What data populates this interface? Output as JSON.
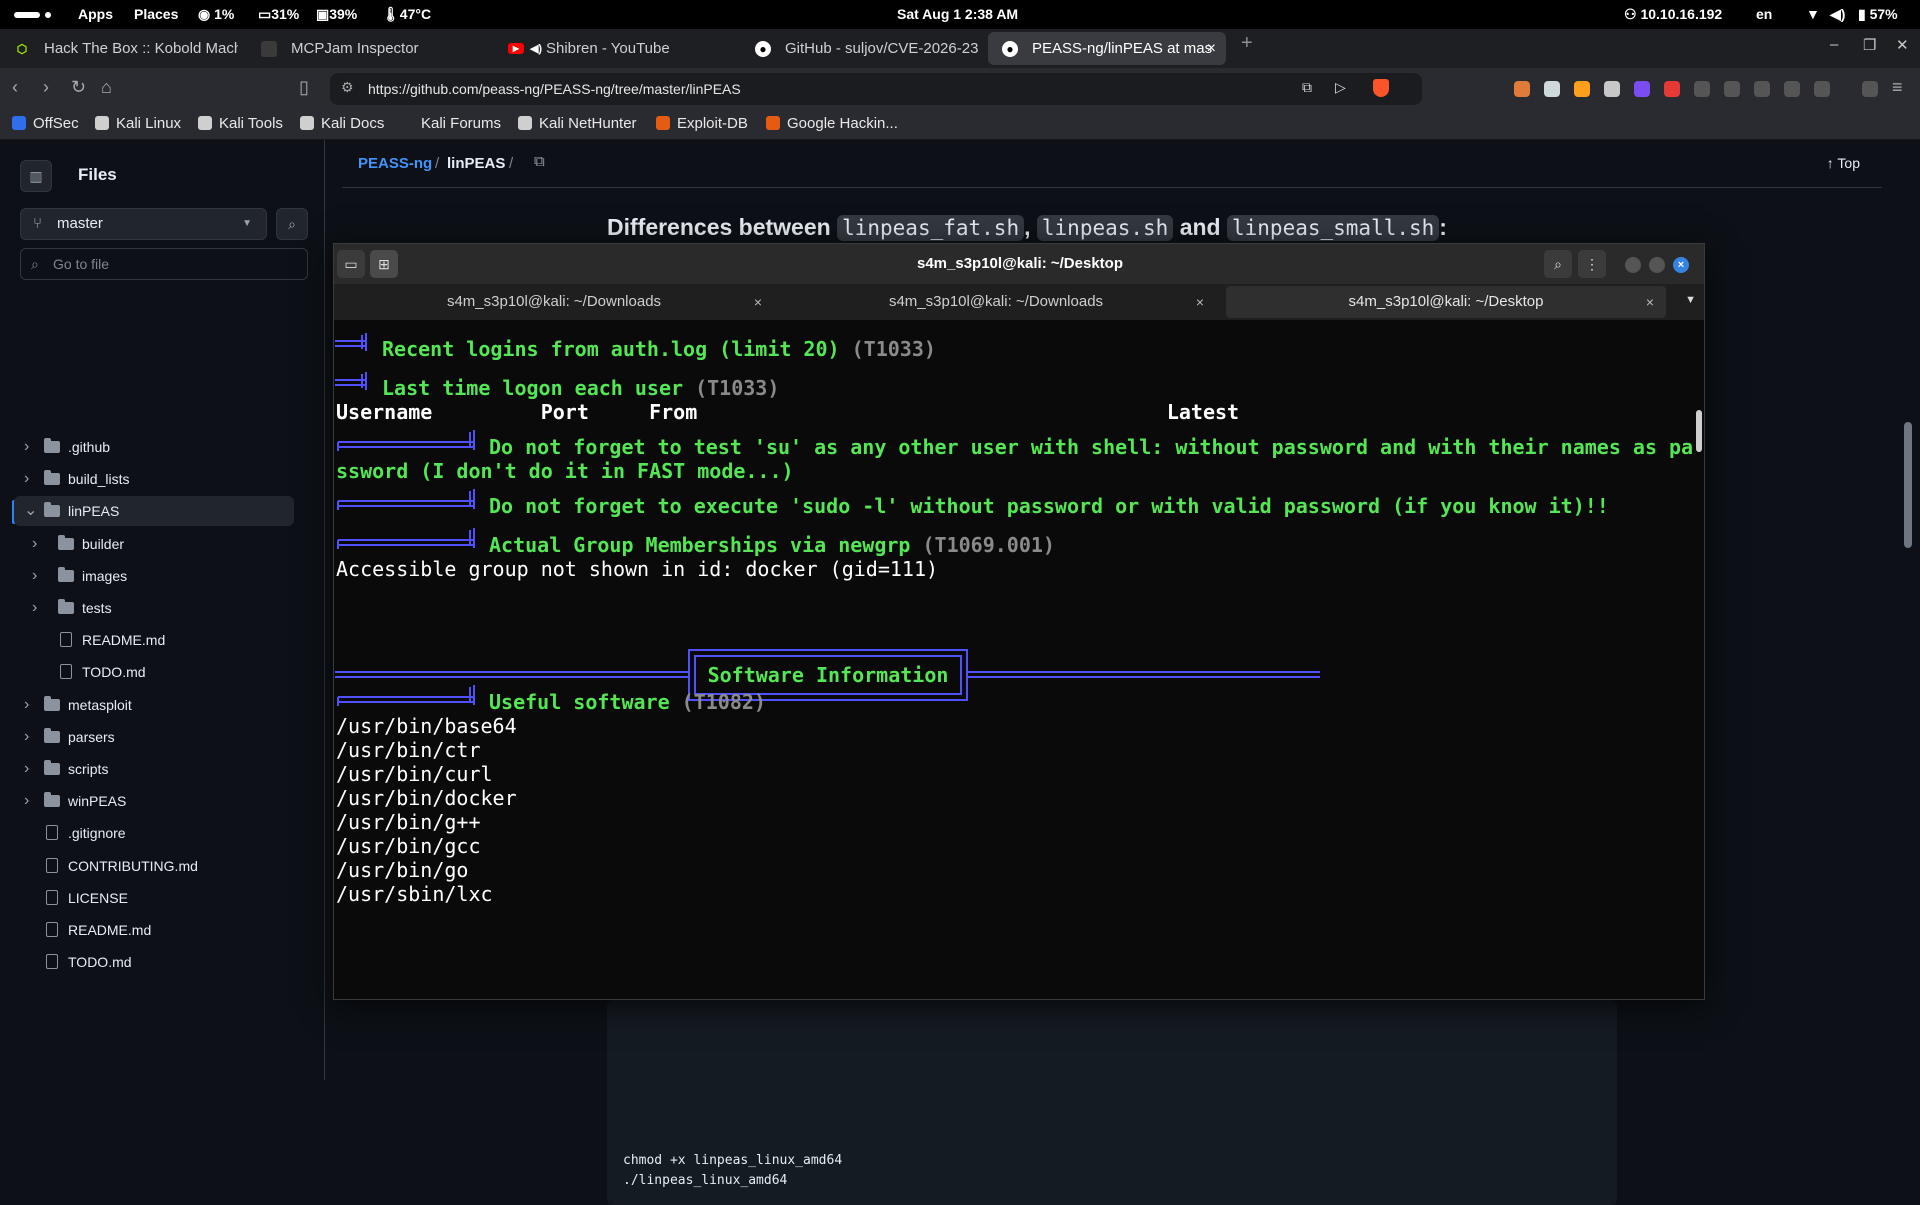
{
  "topbar": {
    "apps": "Apps",
    "places": "Places",
    "cpu": "1%",
    "mem": "31%",
    "swap": "39%",
    "temp": "47°C",
    "datetime": "Sat Aug 1   2:38 AM",
    "ip": "10.10.16.192",
    "lang": "en",
    "battery": "57%"
  },
  "browser_tabs": [
    {
      "label": "Hack The Box :: Kobold Machi",
      "icon_color": "#9fef00"
    },
    {
      "label": "MCPJam Inspector",
      "icon_color": "#3a3a3a"
    },
    {
      "label": "Shibren - YouTube",
      "icon_color": "#ff0000"
    },
    {
      "label": "GitHub - suljov/CVE-2026-23",
      "icon_color": "#ffffff"
    },
    {
      "label": "PEASS-ng/linPEAS at mas",
      "icon_color": "#ffffff"
    }
  ],
  "address": {
    "url": "https://github.com/peass-ng/PEASS-ng/tree/master/linPEAS"
  },
  "bookmarks": [
    "OffSec",
    "Kali Linux",
    "Kali Tools",
    "Kali Docs",
    "Kali Forums",
    "Kali NetHunter",
    "Exploit-DB",
    "Google Hackin..."
  ],
  "github": {
    "files_title": "Files",
    "branch": "master",
    "goto_placeholder": "Go to file",
    "tree": [
      {
        "name": ".github",
        "type": "folder",
        "depth": 0,
        "expanded": false
      },
      {
        "name": "build_lists",
        "type": "folder",
        "depth": 0,
        "expanded": false
      },
      {
        "name": "linPEAS",
        "type": "folder",
        "depth": 0,
        "expanded": true,
        "selected": true
      },
      {
        "name": "builder",
        "type": "folder",
        "depth": 1,
        "expanded": false
      },
      {
        "name": "images",
        "type": "folder",
        "depth": 1,
        "expanded": false
      },
      {
        "name": "tests",
        "type": "folder",
        "depth": 1,
        "expanded": false
      },
      {
        "name": "README.md",
        "type": "file",
        "depth": 1
      },
      {
        "name": "TODO.md",
        "type": "file",
        "depth": 1
      },
      {
        "name": "metasploit",
        "type": "folder",
        "depth": 0,
        "expanded": false
      },
      {
        "name": "parsers",
        "type": "folder",
        "depth": 0,
        "expanded": false
      },
      {
        "name": "scripts",
        "type": "folder",
        "depth": 0,
        "expanded": false
      },
      {
        "name": "winPEAS",
        "type": "folder",
        "depth": 0,
        "expanded": false
      },
      {
        "name": ".gitignore",
        "type": "file",
        "depth": 0
      },
      {
        "name": "CONTRIBUTING.md",
        "type": "file",
        "depth": 0
      },
      {
        "name": "LICENSE",
        "type": "file",
        "depth": 0
      },
      {
        "name": "README.md",
        "type": "file",
        "depth": 0
      },
      {
        "name": "TODO.md",
        "type": "file",
        "depth": 0
      }
    ],
    "breadcrumb": {
      "repo": "PEASS-ng",
      "dir": "linPEAS"
    },
    "top_label": "Top",
    "heading": {
      "prefix": "Differences between ",
      "f1": "linpeas_fat.sh",
      "sep1": ", ",
      "f2": "linpeas.sh",
      "sep2": " and ",
      "f3": "linpeas_small.sh",
      "suffix": ":"
    },
    "code": [
      "chmod +x linpeas_linux_amd64",
      "./linpeas_linux_amd64"
    ]
  },
  "terminal": {
    "title": "s4m_s3p10l@kali: ~/Desktop",
    "tabs": [
      "s4m_s3p10l@kali: ~/Downloads",
      "s4m_s3p10l@kali: ~/Downloads",
      "s4m_s3p10l@kali: ~/Desktop"
    ],
    "active_tab": 2,
    "lines": {
      "recent_logins": "Recent logins from auth.log (limit 20)",
      "recent_logins_tag": "(T1033)",
      "last_logon": "Last time logon each user",
      "last_logon_tag": "(T1033)",
      "table_header": "Username         Port     From                                       Latest",
      "su_hint_1": "Do not forget to test 'su' as any other user with shell: without password and with their names as pa",
      "su_hint_2": "ssword (I don't do it in FAST mode...)",
      "sudo_hint": "Do not forget to execute 'sudo -l' without password or with valid password (if you know it)!!",
      "groups": "Actual Group Memberships via newgrp",
      "groups_tag": "(T1069.001)",
      "groups_result": "Accessible group not shown in id: docker (gid=111)",
      "section": "Software Information",
      "useful": "Useful software",
      "useful_tag": "(T1082)"
    },
    "software": [
      "/usr/bin/base64",
      "/usr/bin/ctr",
      "/usr/bin/curl",
      "/usr/bin/docker",
      "/usr/bin/g++",
      "/usr/bin/gcc",
      "/usr/bin/go",
      "/usr/sbin/lxc"
    ]
  },
  "colors": {
    "term_green": "#55e655",
    "term_box": "#5050ff",
    "gh_link": "#4493f8",
    "kali_blue": "#3584e4"
  }
}
